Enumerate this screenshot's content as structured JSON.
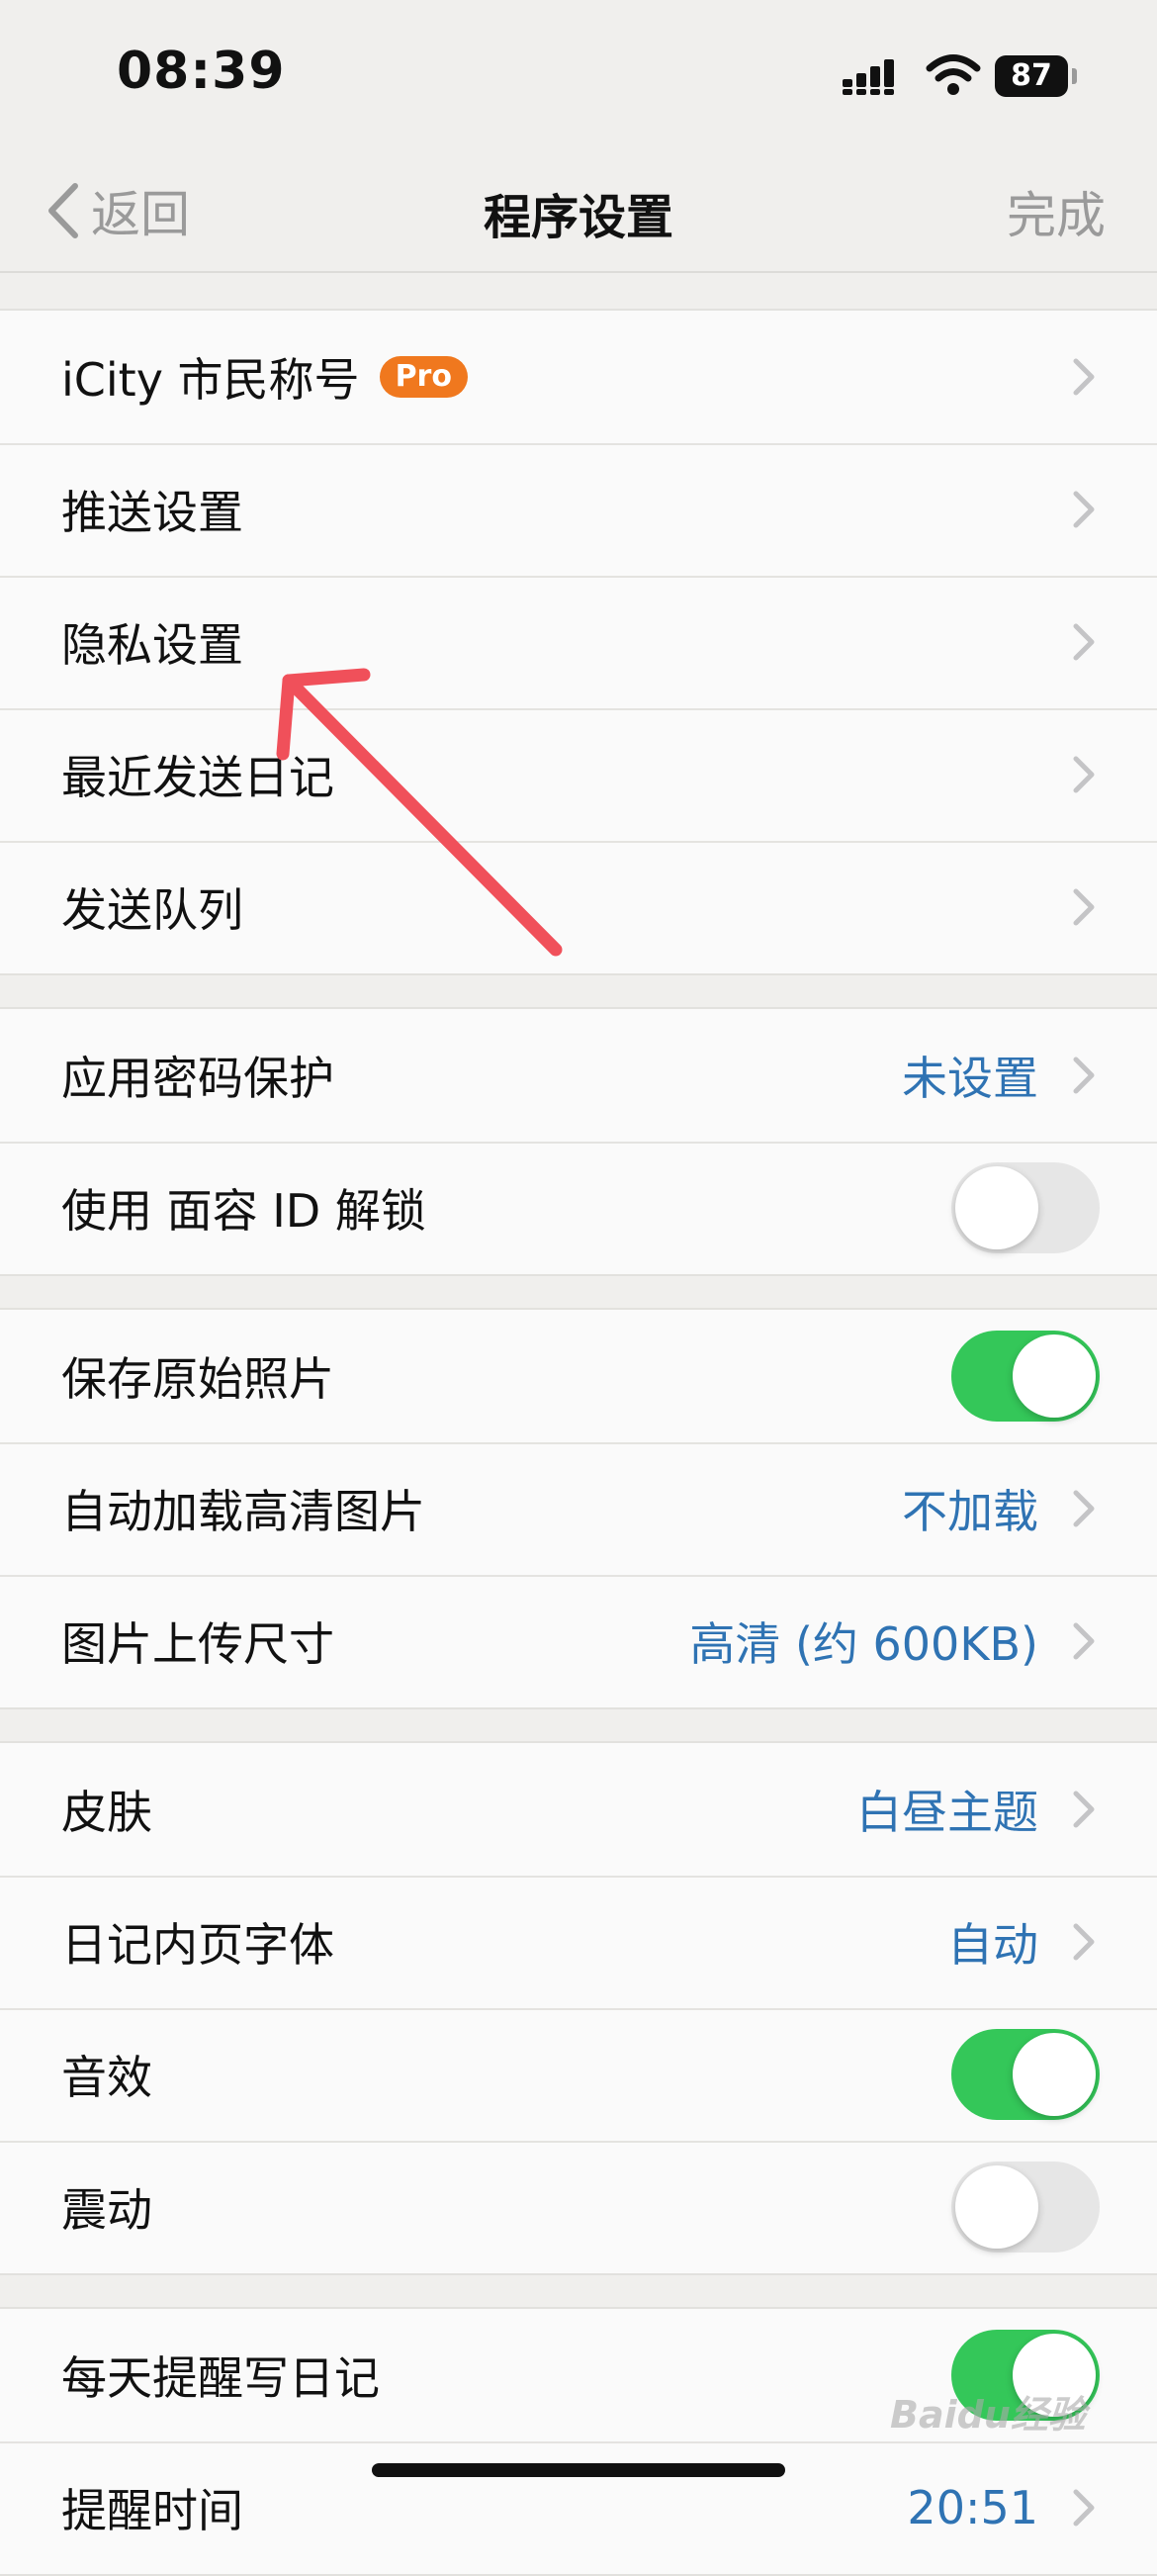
{
  "status_bar": {
    "time": "08:39",
    "battery": "87"
  },
  "nav": {
    "back_label": "返回",
    "title": "程序设置",
    "done_label": "完成"
  },
  "groups": [
    {
      "rows": [
        {
          "label": "iCity 市民称号",
          "badge": "Pro"
        },
        {
          "label": "推送设置"
        },
        {
          "label": "隐私设置"
        },
        {
          "label": "最近发送日记"
        },
        {
          "label": "发送队列"
        }
      ]
    },
    {
      "rows": [
        {
          "label": "应用密码保护",
          "value": "未设置"
        },
        {
          "label": "使用 面容 ID 解锁",
          "toggle": false
        }
      ]
    },
    {
      "rows": [
        {
          "label": "保存原始照片",
          "toggle": true
        },
        {
          "label": "自动加载高清图片",
          "value": "不加载"
        },
        {
          "label": "图片上传尺寸",
          "value": "高清 (约 600KB)"
        }
      ]
    },
    {
      "rows": [
        {
          "label": "皮肤",
          "value": "白昼主题"
        },
        {
          "label": "日记内页字体",
          "value": "自动"
        },
        {
          "label": "音效",
          "toggle": true
        },
        {
          "label": "震动",
          "toggle": false
        }
      ]
    },
    {
      "rows": [
        {
          "label": "每天提醒写日记",
          "toggle": true
        },
        {
          "label": "提醒时间",
          "value": "20:51"
        }
      ]
    }
  ],
  "watermark": "Baidu经验",
  "colors": {
    "accent": "#2f73b3",
    "toggle_on": "#34c759",
    "badge": "#f0781e",
    "arrow": "#f0505a"
  }
}
